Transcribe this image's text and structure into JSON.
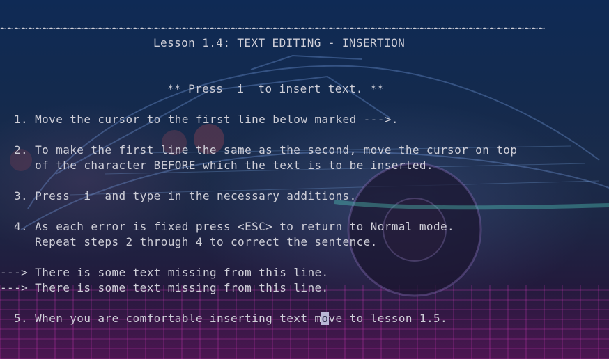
{
  "terminal": {
    "tilde_rule": "~~~~~~~~~~~~~~~~~~~~~~~~~~~~~~~~~~~~~~~~~~~~~~~~~~~~~~~~~~~~~~~~~~~~~~~~~~~~~~",
    "title": "Lesson 1.4: TEXT EDITING - INSERTION",
    "subtitle": "** Press  i  to insert text. **",
    "step1": "1. Move the cursor to the first line below marked --->.",
    "step2a": "2. To make the first line the same as the second, move the cursor on top",
    "step2b": "   of the character BEFORE which the text is to be inserted.",
    "step3": "3. Press  i  and type in the necessary additions.",
    "step4a": "4. As each error is fixed press <ESC> to return to Normal mode.",
    "step4b": "   Repeat steps 2 through 4 to correct the sentence.",
    "example1": "---> There is some text missing from this line.",
    "example2": "---> There is some text missing from this line.",
    "step5_before": "5. When you are comfortable inserting text m",
    "step5_cursor": "o",
    "step5_after": "ve to lesson 1.5."
  }
}
